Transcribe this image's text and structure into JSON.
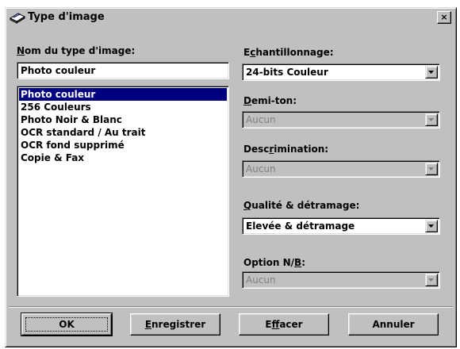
{
  "window": {
    "title": "Type d'image",
    "title_icon": "scanner-icon",
    "close_label": "×"
  },
  "left": {
    "name_label_accel": "N",
    "name_label_rest": "om du type d'image:",
    "name_value": "Photo couleur",
    "list_items": [
      "Photo couleur",
      "256 Couleurs",
      "Photo Noir & Blanc",
      "OCR standard / Au trait",
      "OCR fond supprimé",
      "Copie & Fax"
    ],
    "selected_index": 0
  },
  "right": {
    "sampling_label_a": "E",
    "sampling_label_accel": "c",
    "sampling_label_b": "hantillonnage:",
    "sampling_value": "24-bits Couleur",
    "halftone_label_accel": "D",
    "halftone_label_rest": "emi-ton:",
    "halftone_value": "Aucun",
    "discrim_label_a": "Desc",
    "discrim_label_accel": "r",
    "discrim_label_b": "imination:",
    "discrim_value": "Aucun",
    "quality_label_accel": "Q",
    "quality_label_rest": "ualité & détramage:",
    "quality_value": "Elevée & détramage",
    "option_label_a": "Option N/",
    "option_label_accel": "B",
    "option_label_b": ":",
    "option_value": "Aucun"
  },
  "buttons": {
    "ok": "OK",
    "save_accel": "E",
    "save_rest": "nregistrer",
    "clear_a": "E",
    "clear_accel": "f",
    "clear_b": "facer",
    "cancel": "Annuler"
  },
  "colors": {
    "face": "#c0c0c0",
    "selection": "#000080",
    "disabled_text": "#808080"
  }
}
